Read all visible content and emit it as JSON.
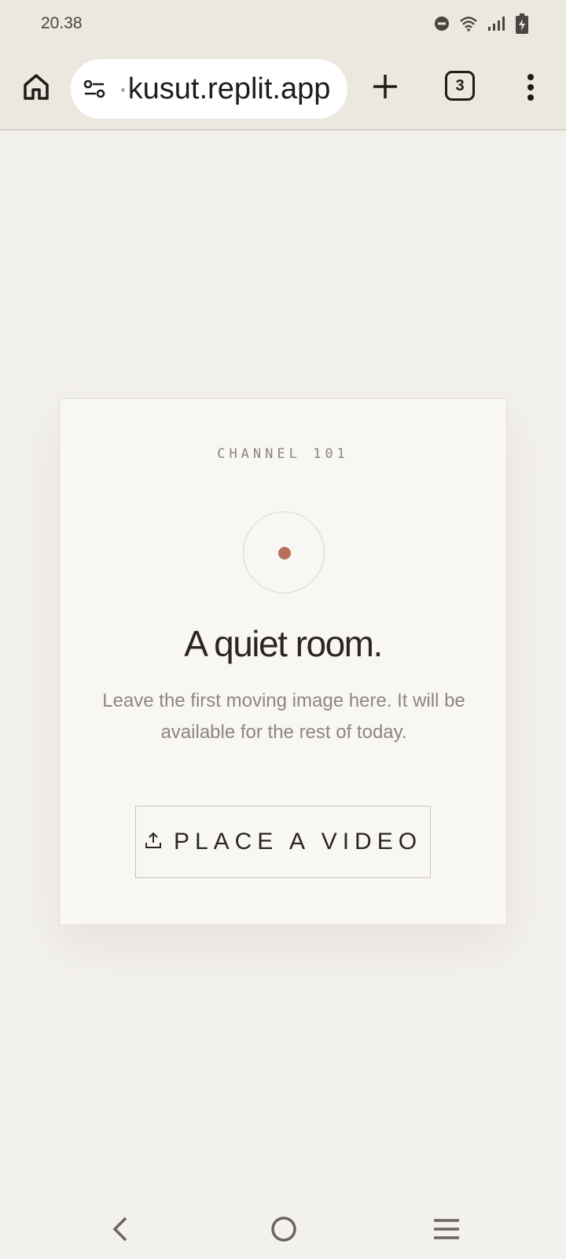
{
  "status_bar": {
    "time": "20.38",
    "icons": [
      "do-not-disturb-icon",
      "wifi-icon",
      "signal-icon",
      "battery-charging-icon"
    ]
  },
  "browser": {
    "url": "·kusut.replit.app",
    "tab_count": "3",
    "icons": [
      "home-icon",
      "site-settings-icon",
      "new-tab-icon",
      "tabs-icon",
      "more-vert-icon"
    ]
  },
  "card": {
    "channel": "CHANNEL 101",
    "title": "A quiet room.",
    "subtitle": "Leave the first moving image here. It will be available for the rest of today.",
    "button_label": "PLACE A VIDEO",
    "accent_color": "#b8705a"
  },
  "nav_bar": {
    "icons": [
      "back-icon",
      "home-circle-icon",
      "recents-icon"
    ]
  }
}
